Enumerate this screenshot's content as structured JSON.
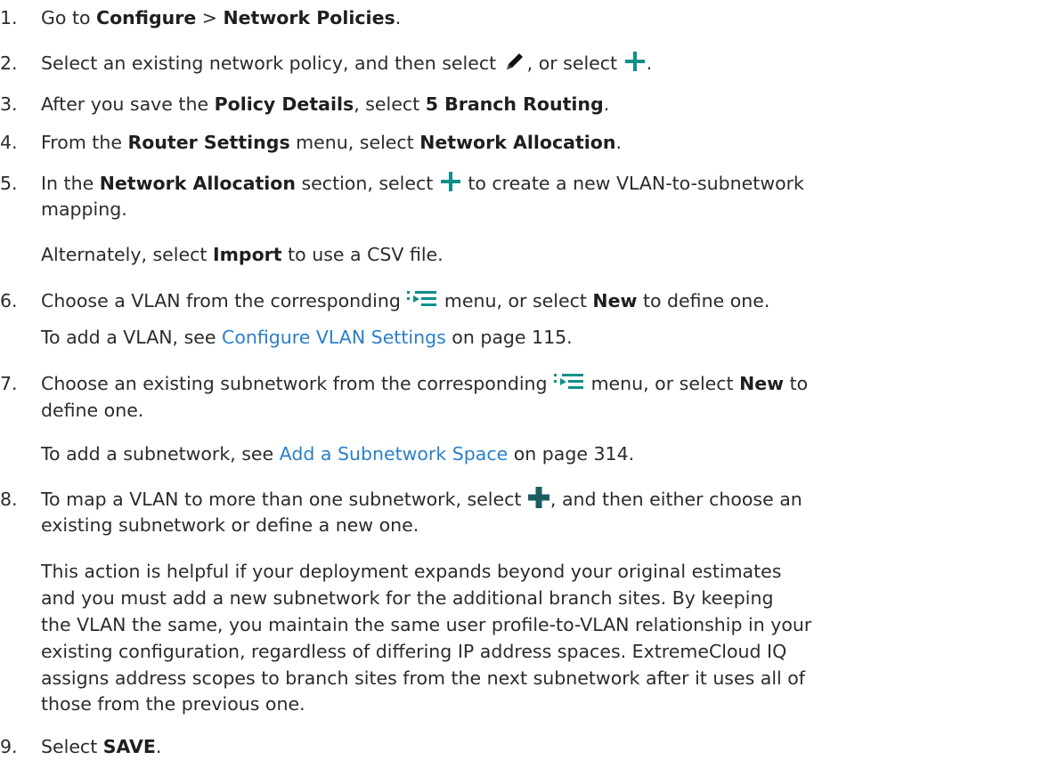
{
  "steps": [
    {
      "num": "1.",
      "pre": "Go to ",
      "b1": "Configure",
      "mid": " > ",
      "b2": "Network Policies",
      "post": "."
    },
    {
      "num": "2.",
      "pre": "Select an existing network policy, and then select ",
      "mid": ", or select ",
      "post": "."
    },
    {
      "num": "3.",
      "pre": "After you save the ",
      "b1": "Policy Details",
      "mid": ", select ",
      "b2": "5 Branch Routing",
      "post": "."
    },
    {
      "num": "4.",
      "pre": "From the ",
      "b1": "Router Settings",
      "mid": " menu, select ",
      "b2": "Network Allocation",
      "post": "."
    },
    {
      "num": "5.",
      "pre": "In the ",
      "b1": "Network Allocation",
      "mid": " section, select ",
      "post": " to create a new VLAN-to-subnetwork",
      "line2": "mapping.",
      "para_pre": "Alternately, select ",
      "para_b": "Import",
      "para_post": " to use a CSV file."
    },
    {
      "num": "6.",
      "pre": "Choose a VLAN from the corresponding ",
      "mid": " menu, or select ",
      "b1": "New",
      "post": " to define one.",
      "para_pre": "To add a VLAN, see ",
      "para_link": "Configure VLAN Settings",
      "para_post": " on page 115."
    },
    {
      "num": "7.",
      "pre": "Choose an existing subnetwork from the corresponding ",
      "mid": " menu, or select ",
      "b1": "New",
      "post": " to",
      "line2": "define one.",
      "para_pre": "To add a subnetwork, see ",
      "para_link": "Add a Subnetwork Space",
      "para_post": " on page 314."
    },
    {
      "num": "8.",
      "pre": "To map a VLAN to more than one subnetwork, select ",
      "post": ", and then either choose an",
      "line2": "existing subnetwork or define a new one.",
      "para_lines": [
        "This action is helpful if your deployment expands beyond your original estimates",
        "and you must add a new subnetwork for the additional branch sites. By keeping",
        "the VLAN the same, you maintain the same user profile-to-VLAN relationship in your",
        "existing configuration, regardless of differing IP address spaces. ExtremeCloud IQ",
        "assigns address scopes to branch sites from the next subnetwork after it uses all of",
        "those from the previous one."
      ]
    },
    {
      "num": "9.",
      "pre": "Select ",
      "b1": "SAVE",
      "post": "."
    }
  ],
  "icons": {
    "edit": "pencil-icon",
    "add": "plus-icon",
    "menu": "list-menu-icon",
    "add_dark": "plus-dark-icon",
    "accent": "#0e8f8a",
    "link_color": "#2a7fc9"
  }
}
